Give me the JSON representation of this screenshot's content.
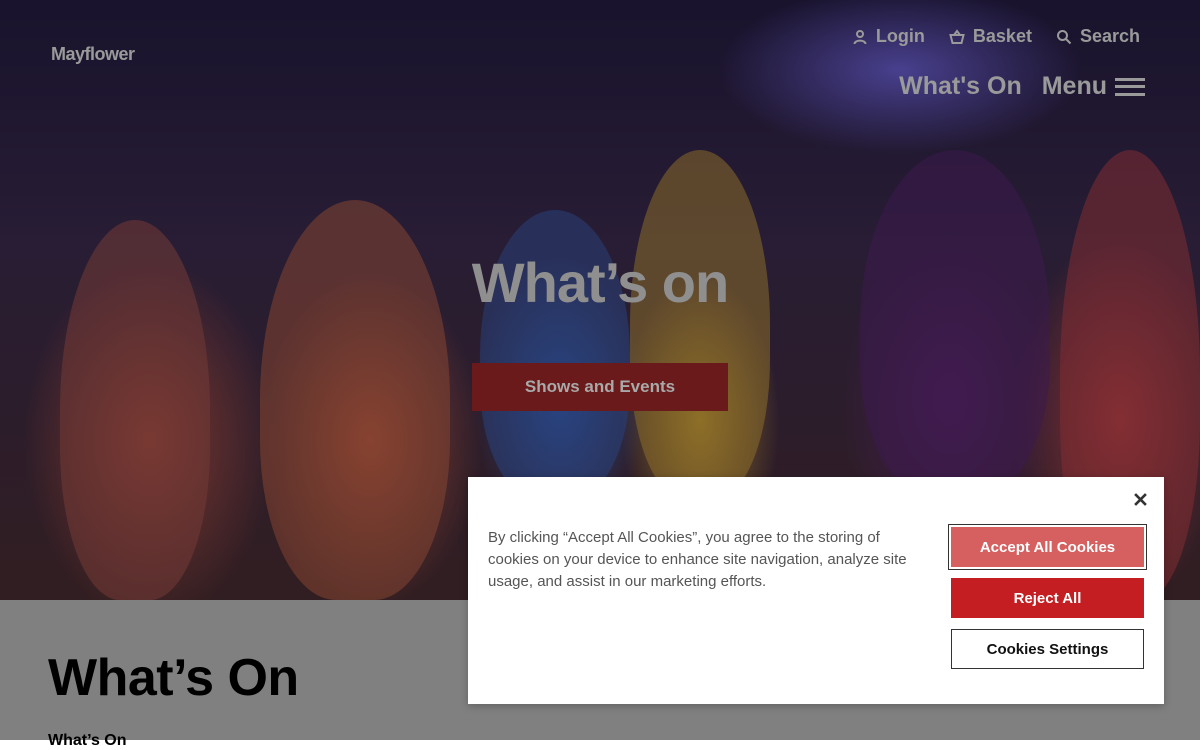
{
  "header": {
    "logo_text": "Mayflower",
    "utility_links": [
      {
        "label": "Login",
        "icon": "user-icon"
      },
      {
        "label": "Basket",
        "icon": "basket-icon"
      },
      {
        "label": "Search",
        "icon": "search-icon"
      }
    ],
    "nav": {
      "whats_on_label": "What's On",
      "menu_label": "Menu"
    }
  },
  "hero": {
    "title": "What’s on",
    "cta_label": "Shows and Events"
  },
  "page": {
    "heading": "What’s On",
    "breadcrumb": "What’s On"
  },
  "cookie_banner": {
    "text": "By clicking “Accept All Cookies”, you agree to the storing of cookies on your device to enhance site navigation, analyze site usage, and assist in our marketing efforts.",
    "accept_label": "Accept All Cookies",
    "reject_label": "Reject All",
    "settings_label": "Cookies Settings"
  },
  "colors": {
    "accept_bg": "#d65f5f",
    "reject_bg": "#c41e22",
    "hero_cta_bg": "#6a1a1a",
    "overlay_gray": "#808080"
  }
}
